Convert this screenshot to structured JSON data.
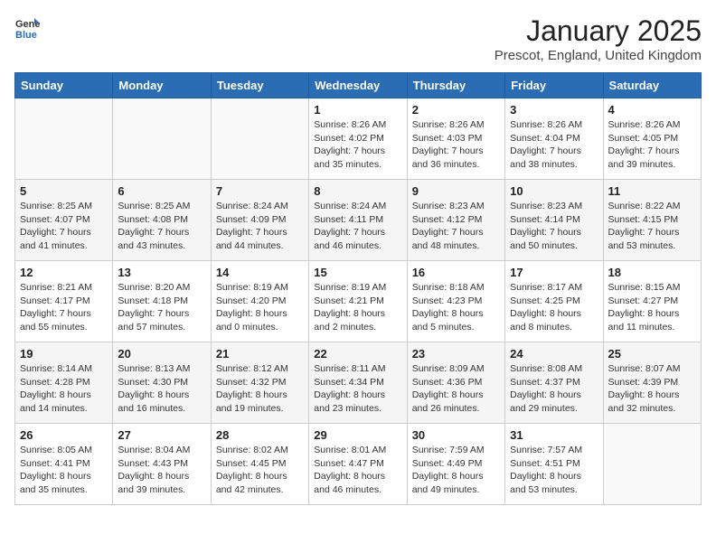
{
  "logo": {
    "general": "General",
    "blue": "Blue"
  },
  "title": "January 2025",
  "subtitle": "Prescot, England, United Kingdom",
  "weekdays": [
    "Sunday",
    "Monday",
    "Tuesday",
    "Wednesday",
    "Thursday",
    "Friday",
    "Saturday"
  ],
  "weeks": [
    [
      {
        "day": "",
        "info": ""
      },
      {
        "day": "",
        "info": ""
      },
      {
        "day": "",
        "info": ""
      },
      {
        "day": "1",
        "info": "Sunrise: 8:26 AM\nSunset: 4:02 PM\nDaylight: 7 hours\nand 35 minutes."
      },
      {
        "day": "2",
        "info": "Sunrise: 8:26 AM\nSunset: 4:03 PM\nDaylight: 7 hours\nand 36 minutes."
      },
      {
        "day": "3",
        "info": "Sunrise: 8:26 AM\nSunset: 4:04 PM\nDaylight: 7 hours\nand 38 minutes."
      },
      {
        "day": "4",
        "info": "Sunrise: 8:26 AM\nSunset: 4:05 PM\nDaylight: 7 hours\nand 39 minutes."
      }
    ],
    [
      {
        "day": "5",
        "info": "Sunrise: 8:25 AM\nSunset: 4:07 PM\nDaylight: 7 hours\nand 41 minutes."
      },
      {
        "day": "6",
        "info": "Sunrise: 8:25 AM\nSunset: 4:08 PM\nDaylight: 7 hours\nand 43 minutes."
      },
      {
        "day": "7",
        "info": "Sunrise: 8:24 AM\nSunset: 4:09 PM\nDaylight: 7 hours\nand 44 minutes."
      },
      {
        "day": "8",
        "info": "Sunrise: 8:24 AM\nSunset: 4:11 PM\nDaylight: 7 hours\nand 46 minutes."
      },
      {
        "day": "9",
        "info": "Sunrise: 8:23 AM\nSunset: 4:12 PM\nDaylight: 7 hours\nand 48 minutes."
      },
      {
        "day": "10",
        "info": "Sunrise: 8:23 AM\nSunset: 4:14 PM\nDaylight: 7 hours\nand 50 minutes."
      },
      {
        "day": "11",
        "info": "Sunrise: 8:22 AM\nSunset: 4:15 PM\nDaylight: 7 hours\nand 53 minutes."
      }
    ],
    [
      {
        "day": "12",
        "info": "Sunrise: 8:21 AM\nSunset: 4:17 PM\nDaylight: 7 hours\nand 55 minutes."
      },
      {
        "day": "13",
        "info": "Sunrise: 8:20 AM\nSunset: 4:18 PM\nDaylight: 7 hours\nand 57 minutes."
      },
      {
        "day": "14",
        "info": "Sunrise: 8:19 AM\nSunset: 4:20 PM\nDaylight: 8 hours\nand 0 minutes."
      },
      {
        "day": "15",
        "info": "Sunrise: 8:19 AM\nSunset: 4:21 PM\nDaylight: 8 hours\nand 2 minutes."
      },
      {
        "day": "16",
        "info": "Sunrise: 8:18 AM\nSunset: 4:23 PM\nDaylight: 8 hours\nand 5 minutes."
      },
      {
        "day": "17",
        "info": "Sunrise: 8:17 AM\nSunset: 4:25 PM\nDaylight: 8 hours\nand 8 minutes."
      },
      {
        "day": "18",
        "info": "Sunrise: 8:15 AM\nSunset: 4:27 PM\nDaylight: 8 hours\nand 11 minutes."
      }
    ],
    [
      {
        "day": "19",
        "info": "Sunrise: 8:14 AM\nSunset: 4:28 PM\nDaylight: 8 hours\nand 14 minutes."
      },
      {
        "day": "20",
        "info": "Sunrise: 8:13 AM\nSunset: 4:30 PM\nDaylight: 8 hours\nand 16 minutes."
      },
      {
        "day": "21",
        "info": "Sunrise: 8:12 AM\nSunset: 4:32 PM\nDaylight: 8 hours\nand 19 minutes."
      },
      {
        "day": "22",
        "info": "Sunrise: 8:11 AM\nSunset: 4:34 PM\nDaylight: 8 hours\nand 23 minutes."
      },
      {
        "day": "23",
        "info": "Sunrise: 8:09 AM\nSunset: 4:36 PM\nDaylight: 8 hours\nand 26 minutes."
      },
      {
        "day": "24",
        "info": "Sunrise: 8:08 AM\nSunset: 4:37 PM\nDaylight: 8 hours\nand 29 minutes."
      },
      {
        "day": "25",
        "info": "Sunrise: 8:07 AM\nSunset: 4:39 PM\nDaylight: 8 hours\nand 32 minutes."
      }
    ],
    [
      {
        "day": "26",
        "info": "Sunrise: 8:05 AM\nSunset: 4:41 PM\nDaylight: 8 hours\nand 35 minutes."
      },
      {
        "day": "27",
        "info": "Sunrise: 8:04 AM\nSunset: 4:43 PM\nDaylight: 8 hours\nand 39 minutes."
      },
      {
        "day": "28",
        "info": "Sunrise: 8:02 AM\nSunset: 4:45 PM\nDaylight: 8 hours\nand 42 minutes."
      },
      {
        "day": "29",
        "info": "Sunrise: 8:01 AM\nSunset: 4:47 PM\nDaylight: 8 hours\nand 46 minutes."
      },
      {
        "day": "30",
        "info": "Sunrise: 7:59 AM\nSunset: 4:49 PM\nDaylight: 8 hours\nand 49 minutes."
      },
      {
        "day": "31",
        "info": "Sunrise: 7:57 AM\nSunset: 4:51 PM\nDaylight: 8 hours\nand 53 minutes."
      },
      {
        "day": "",
        "info": ""
      }
    ]
  ]
}
